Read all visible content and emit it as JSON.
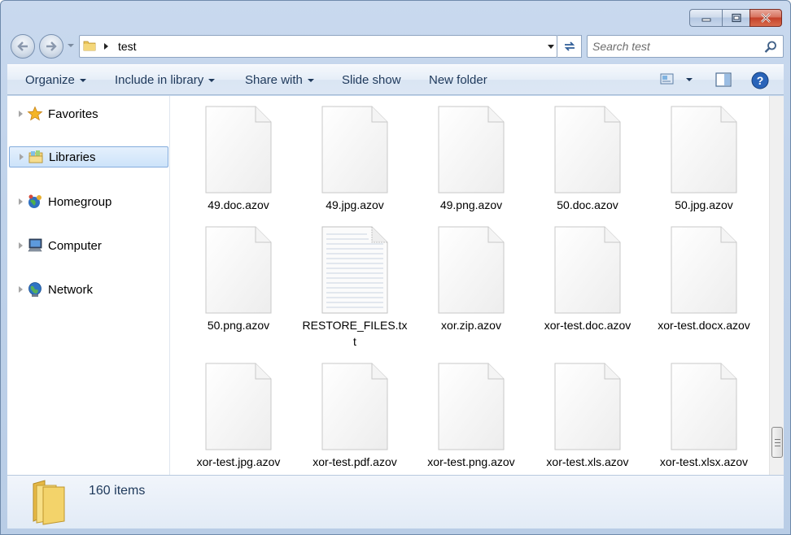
{
  "window": {
    "caption": {
      "minimize": "minimize",
      "maximize": "maximize",
      "close": "close"
    }
  },
  "address_bar": {
    "path": "test",
    "search_placeholder": "Search test"
  },
  "toolbar": {
    "organize": "Organize",
    "include_in_library": "Include in library",
    "share_with": "Share with",
    "slide_show": "Slide show",
    "new_folder": "New folder"
  },
  "navigation": {
    "items": [
      {
        "label": "Favorites",
        "icon": "star-icon"
      },
      {
        "label": "Libraries",
        "icon": "libraries-icon",
        "selected": true
      },
      {
        "label": "Homegroup",
        "icon": "homegroup-icon"
      },
      {
        "label": "Computer",
        "icon": "computer-icon"
      },
      {
        "label": "Network",
        "icon": "network-icon"
      }
    ]
  },
  "files": [
    {
      "name": "49.doc.azov",
      "type": "blank"
    },
    {
      "name": "49.jpg.azov",
      "type": "blank"
    },
    {
      "name": "49.png.azov",
      "type": "blank"
    },
    {
      "name": "50.doc.azov",
      "type": "blank"
    },
    {
      "name": "50.jpg.azov",
      "type": "blank"
    },
    {
      "name": "50.png.azov",
      "type": "blank"
    },
    {
      "name": "RESTORE_FILES.txt",
      "type": "text"
    },
    {
      "name": "xor.zip.azov",
      "type": "blank"
    },
    {
      "name": "xor-test.doc.azov",
      "type": "blank"
    },
    {
      "name": "xor-test.docx.azov",
      "type": "blank"
    },
    {
      "name": "xor-test.jpg.azov",
      "type": "blank"
    },
    {
      "name": "xor-test.pdf.azov",
      "type": "blank"
    },
    {
      "name": "xor-test.png.azov",
      "type": "blank"
    },
    {
      "name": "xor-test.xls.azov",
      "type": "blank"
    },
    {
      "name": "xor-test.xlsx.azov",
      "type": "blank"
    }
  ],
  "details": {
    "item_count": "160 items"
  },
  "colors": {
    "frame": "#c4d5ec",
    "toolbar_text": "#1e395b",
    "selection_border": "#84acdd",
    "close_button": "#c4412a"
  }
}
